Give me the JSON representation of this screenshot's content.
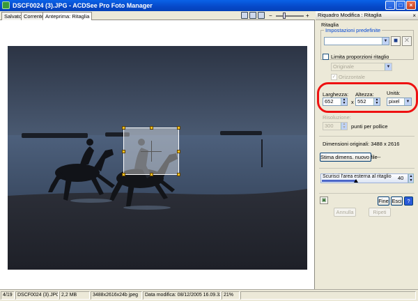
{
  "window": {
    "title": "DSCF0024 (3).JPG - ACDSee Pro Foto Manager",
    "minimize": "_",
    "maximize": "□",
    "close": "×"
  },
  "tabs": [
    {
      "label": "Salvato"
    },
    {
      "label": "Corrente"
    },
    {
      "label": "Anteprima: Ritaglia"
    }
  ],
  "toolbar": {
    "zoom_minus": "−",
    "zoom_plus": "+",
    "zoom_level": 0.3
  },
  "panel": {
    "header": "Riquadro Modifica : Ritaglia",
    "close": "×",
    "section_title": "Ritaglia",
    "presets_legend": "Impostazioni predefinite",
    "preset_value": "",
    "limit_ratio_label": "Limita proporzioni ritaglio",
    "ratio_value": "Originale",
    "horizontal_label": "Orizzontale",
    "horizontal_mark": "✓",
    "width_label": "Larghezza:",
    "width_value": "652",
    "times": "x",
    "height_label": "Altezza:",
    "height_value": "552",
    "unit_label": "Unità:",
    "unit_value": "pixel",
    "resolution_label": "Risoluzione:",
    "resolution_value": "300",
    "resolution_unit": "punti per pollice",
    "original_dims": "Dimensioni originali: 3488 x 2616",
    "estimate_button": "Stima dimens. nuovo file",
    "estimate_result": "---",
    "darken_label": "Scurisci l'area esterna al ritaglio",
    "darken_value": "40",
    "darken_fraction": 0.4,
    "fine_button": "Fine",
    "exit_button": "Esci",
    "help_button": "?",
    "undo_button": "Annulla",
    "redo_button": "Ripeti"
  },
  "status": {
    "index": "4/19",
    "filename": "DSCF0024 (3).JPG",
    "size": "2,2 MB",
    "dims": "3488x2616x24b jpeg",
    "modified": "Data modifica: 08/12/2005 16.09.32",
    "zoom": "21%"
  },
  "colors": {
    "annotation": "#ee1111",
    "crop_handle": "#f0c020",
    "titlebar": "#0648c8"
  }
}
